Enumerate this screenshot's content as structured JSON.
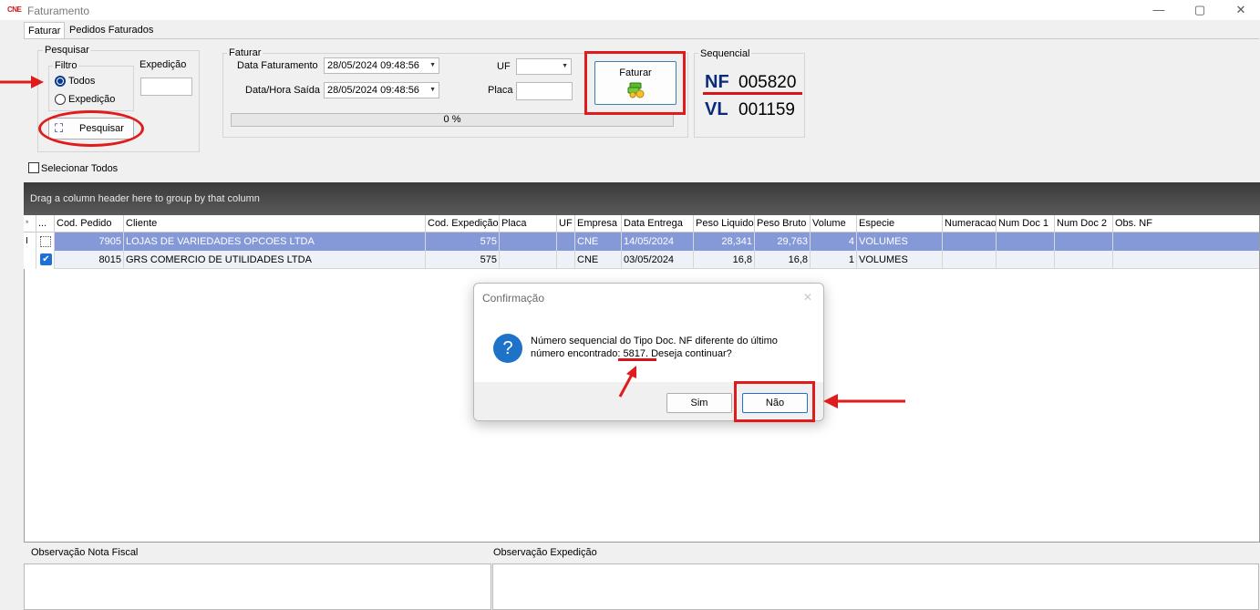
{
  "window": {
    "logo": "CNE",
    "title": "Faturamento",
    "minimize": "—",
    "maximize": "▢",
    "close": "✕"
  },
  "tabs": [
    "Faturar",
    "Pedidos Faturados"
  ],
  "pesquisar": {
    "legend": "Pesquisar",
    "filtro_legend": "Filtro",
    "radio_todos": "Todos",
    "radio_expedicao": "Expedição",
    "expedicao_label": "Expedição",
    "expedicao_value": "",
    "button": "Pesquisar"
  },
  "select_all": "Selecionar Todos",
  "faturar": {
    "legend": "Faturar",
    "data_faturamento_label": "Data Faturamento",
    "data_faturamento_value": "28/05/2024 09:48:56",
    "data_saida_label": "Data/Hora Saída",
    "data_saida_value": "28/05/2024 09:48:56",
    "uf_label": "UF",
    "uf_value": "",
    "placa_label": "Placa",
    "placa_value": "",
    "progress_text": "0 %",
    "progress": 0,
    "button": "Faturar"
  },
  "sequencial": {
    "legend": "Sequencial",
    "nf_label": "NF",
    "nf_value": "005820",
    "vl_label": "VL",
    "vl_value": "001159"
  },
  "grid": {
    "group_hint": "Drag a column header here to group by that column",
    "columns": [
      "*",
      "...",
      "Cod. Pedido",
      "Cliente",
      "Cod. Expedição",
      "Placa",
      "UF",
      "Empresa",
      "Data Entrega",
      "Peso Liquido",
      "Peso Bruto",
      "Volume",
      "Especie",
      "Numeracao",
      "Num Doc 1",
      "Num Doc 2",
      "Obs. NF"
    ],
    "rows": [
      {
        "indicator": "I",
        "cod_pedido": "7905",
        "cliente": "LOJAS DE VARIEDADES OPCOES LTDA",
        "cod_expedicao": "575",
        "placa": "",
        "uf": "",
        "empresa": "CNE",
        "data_entrega": "14/05/2024",
        "peso_liquido": "28,341",
        "peso_bruto": "29,763",
        "volume": "4",
        "especie": "VOLUMES",
        "numeracao": "",
        "num_doc1": "",
        "num_doc2": "",
        "obs_nf": ""
      },
      {
        "indicator": "",
        "cod_pedido": "8015",
        "cliente": "GRS COMERCIO DE UTILIDADES LTDA",
        "cod_expedicao": "575",
        "placa": "",
        "uf": "",
        "empresa": "CNE",
        "data_entrega": "03/05/2024",
        "peso_liquido": "16,8",
        "peso_bruto": "16,8",
        "volume": "1",
        "especie": "VOLUMES",
        "numeracao": "",
        "num_doc1": "",
        "num_doc2": "",
        "obs_nf": ""
      }
    ]
  },
  "dialog": {
    "title": "Confirmação",
    "close": "✕",
    "message_line1": "Número sequencial do Tipo Doc. NF diferente do último",
    "message_line2_prefix": "número encontrado",
    "message_line2_number": ": 5817",
    "message_line2_suffix": ". Deseja continuar?",
    "icon": "?",
    "yes": "Sim",
    "no": "Não"
  },
  "observacao_nf_label": "Observação Nota Fiscal",
  "observacao_expedicao_label": "Observação Expedição",
  "colors": {
    "annotation_red": "#e01b1b",
    "selected_row": "#8599d9",
    "nf_blue": "#0b2a7a"
  }
}
